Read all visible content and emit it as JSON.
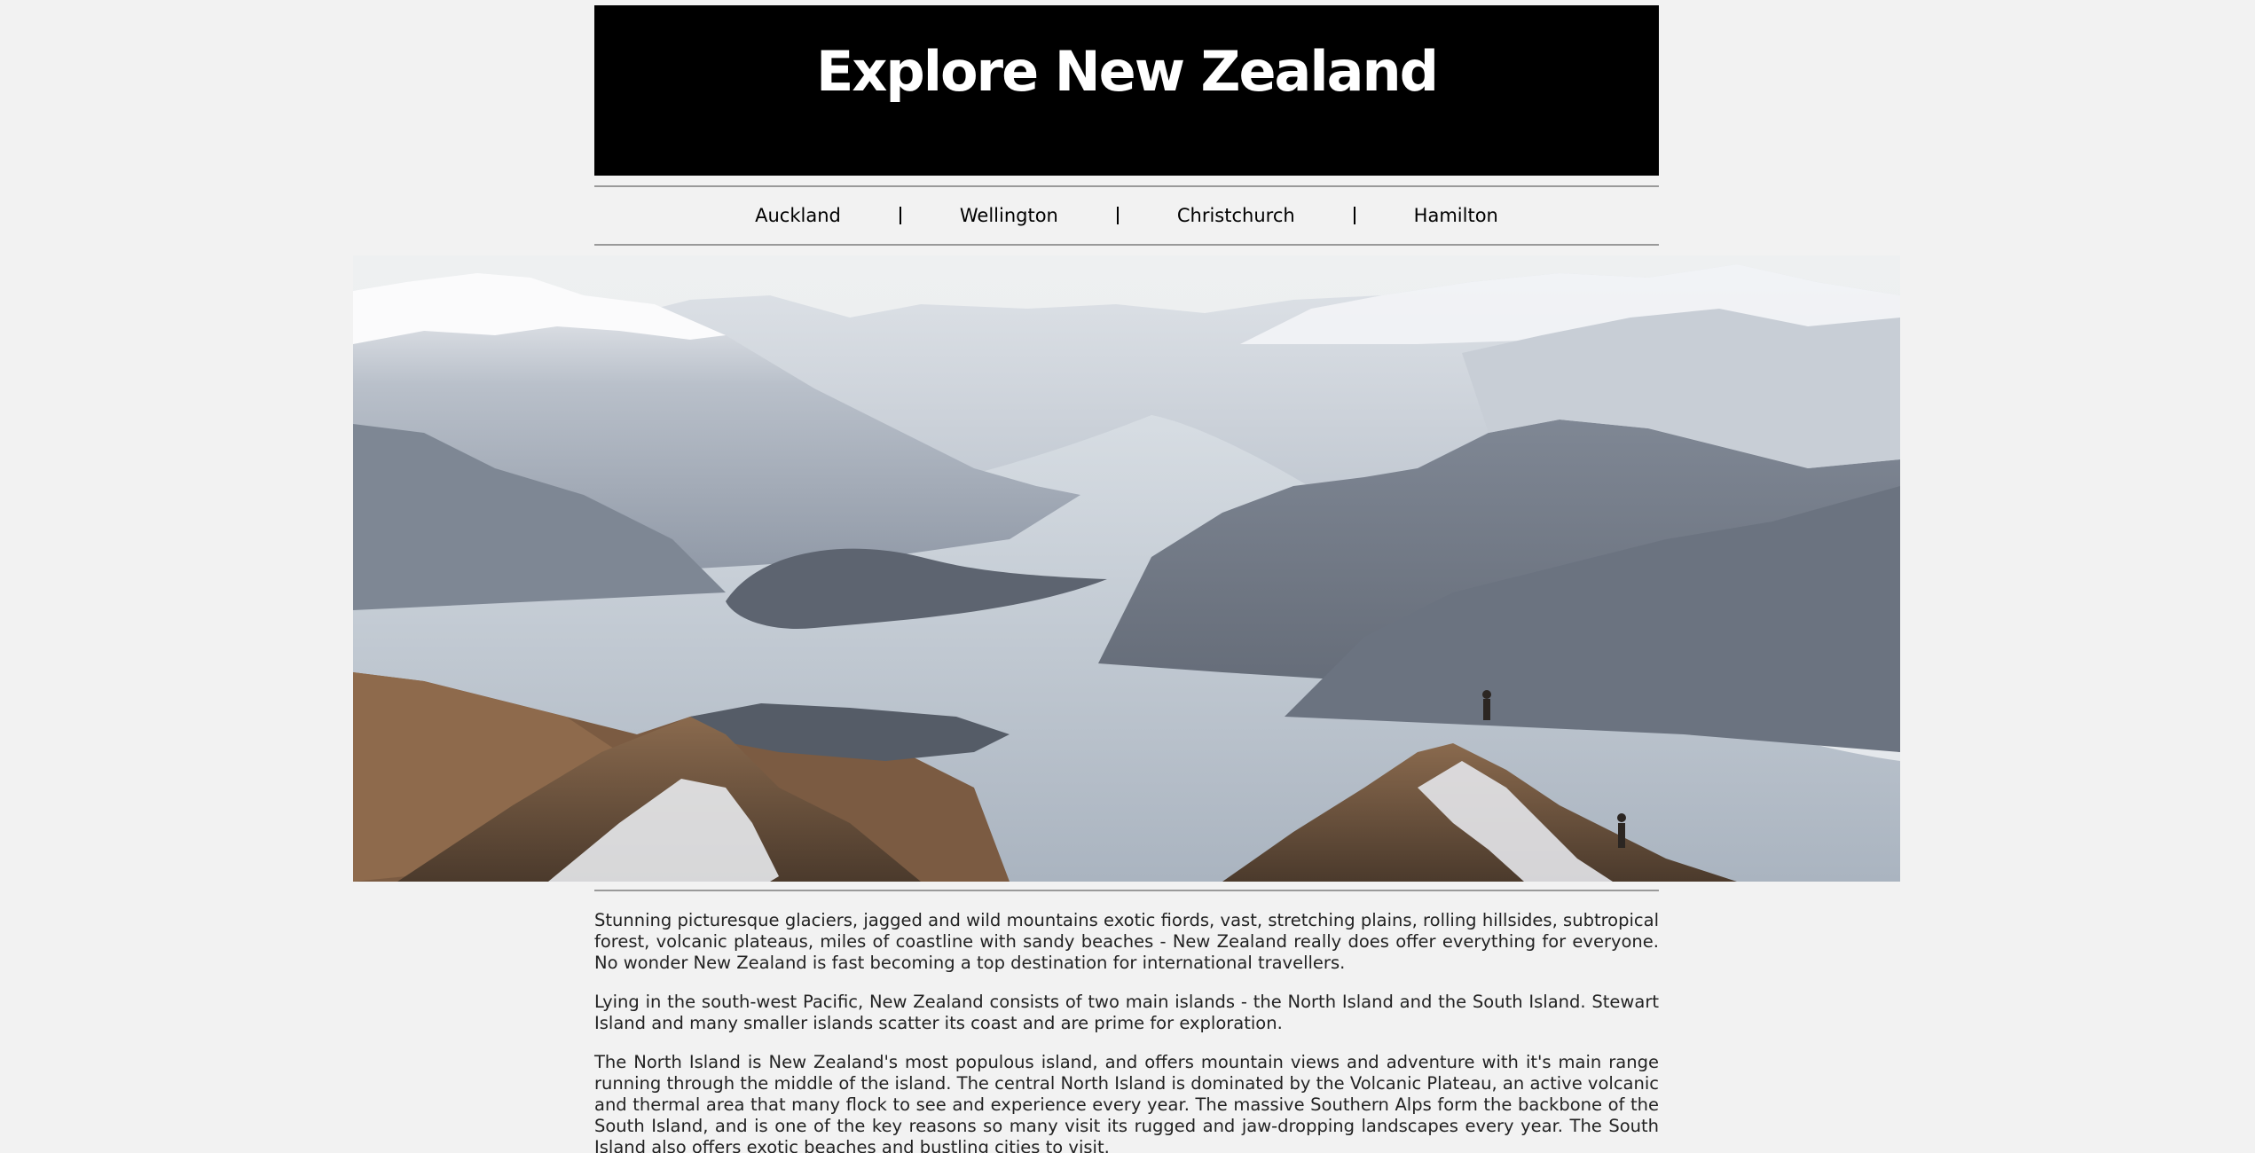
{
  "header": {
    "title": "Explore New Zealand"
  },
  "nav": {
    "items": [
      {
        "label": "Auckland"
      },
      {
        "label": "Wellington"
      },
      {
        "label": "Christchurch"
      },
      {
        "label": "Hamilton"
      }
    ]
  },
  "hero": {
    "image": "mountain-lake-landscape"
  },
  "content": {
    "paragraphs": [
      "Stunning picturesque glaciers, jagged and wild mountains exotic fiords, vast, stretching plains, rolling hillsides, subtropical forest, volcanic plateaus, miles of coastline with sandy beaches - New Zealand really does offer everything for everyone. No wonder New Zealand is fast becoming a top destination for international travellers.",
      "Lying in the south-west Pacific, New Zealand consists of two main islands - the North Island and the South Island. Stewart Island and many smaller islands scatter its coast and are prime for exploration.",
      "The North Island is New Zealand's most populous island, and offers mountain views and adventure with it's main range running through the middle of the island. The central North Island is dominated by the Volcanic Plateau, an active volcanic and thermal area that many flock to see and experience every year. The massive Southern Alps form the backbone of the South Island, and is one of the key reasons so many visit its rugged and jaw-dropping landscapes every year. The South Island also offers exotic beaches and bustling cities to visit."
    ]
  },
  "colors": {
    "page_background": "#f2f2f2",
    "header_background": "#000000",
    "header_text": "#ffffff",
    "body_text": "#222222"
  }
}
